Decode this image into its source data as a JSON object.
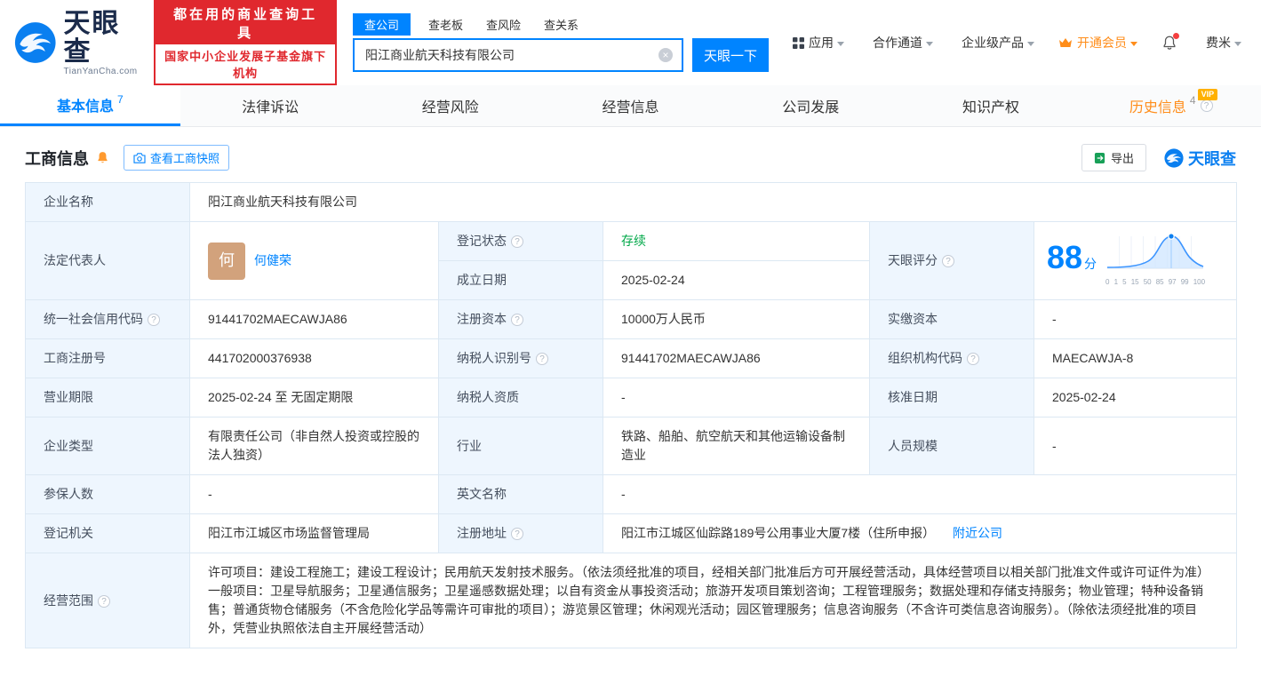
{
  "header": {
    "logo_title": "天眼查",
    "logo_domain": "TianYanCha.com",
    "slogan_line1": "都在用的商业查询工具",
    "slogan_line2": "国家中小企业发展子基金旗下机构",
    "search_tabs": [
      {
        "label": "查公司"
      },
      {
        "label": "查老板"
      },
      {
        "label": "查风险"
      },
      {
        "label": "查关系"
      }
    ],
    "search_value": "阳江商业航天科技有限公司",
    "search_button": "天眼一下",
    "nav_app": "应用",
    "nav_coop": "合作通道",
    "nav_enterprise": "企业级产品",
    "nav_vip": "开通会员",
    "nav_user": "费米"
  },
  "tabs": {
    "basic": {
      "label": "基本信息",
      "count": "7"
    },
    "legal": {
      "label": "法律诉讼"
    },
    "risk": {
      "label": "经营风险"
    },
    "operation": {
      "label": "经营信息"
    },
    "development": {
      "label": "公司发展"
    },
    "ip": {
      "label": "知识产权"
    },
    "history": {
      "label": "历史信息",
      "count": "4",
      "vip_tag": "VIP"
    }
  },
  "section": {
    "title": "工商信息",
    "snapshot_button": "查看工商快照",
    "export_button": "导出",
    "watermark": "天眼查"
  },
  "biz": {
    "company_name_label": "企业名称",
    "company_name_value": "阳江商业航天科技有限公司",
    "legal_rep_label": "法定代表人",
    "legal_rep_avatar": "何",
    "legal_rep_name": "何健荣",
    "reg_status_label": "登记状态",
    "reg_status_value": "存续",
    "score_label": "天眼评分",
    "score_value": "88",
    "score_unit": "分",
    "establish_label": "成立日期",
    "establish_value": "2025-02-24",
    "credit_code_label": "统一社会信用代码",
    "credit_code_value": "91441702MAECAWJA86",
    "reg_capital_label": "注册资本",
    "reg_capital_value": "10000万人民币",
    "paid_capital_label": "实缴资本",
    "paid_capital_value": "-",
    "reg_no_label": "工商注册号",
    "reg_no_value": "441702000376938",
    "taxpayer_id_label": "纳税人识别号",
    "taxpayer_id_value": "91441702MAECAWJA86",
    "org_code_label": "组织机构代码",
    "org_code_value": "MAECAWJA-8",
    "term_label": "营业期限",
    "term_value": "2025-02-24 至 无固定期限",
    "taxpayer_quality_label": "纳税人资质",
    "taxpayer_quality_value": "-",
    "approve_date_label": "核准日期",
    "approve_date_value": "2025-02-24",
    "company_type_label": "企业类型",
    "company_type_value": "有限责任公司（非自然人投资或控股的法人独资）",
    "industry_label": "行业",
    "industry_value": "铁路、船舶、航空航天和其他运输设备制造业",
    "staff_label": "人员规模",
    "staff_value": "-",
    "insured_label": "参保人数",
    "insured_value": "-",
    "english_label": "英文名称",
    "english_value": "-",
    "authority_label": "登记机关",
    "authority_value": "阳江市江城区市场监督管理局",
    "address_label": "注册地址",
    "address_value": "阳江市江城区仙踪路189号公用事业大厦7楼（住所申报）",
    "nearby_link": "附近公司",
    "scope_label": "经营范围",
    "scope_value": "许可项目：建设工程施工；建设工程设计；民用航天发射技术服务。（依法须经批准的项目，经相关部门批准后方可开展经营活动，具体经营项目以相关部门批准文件或许可证件为准）一般项目：卫星导航服务；卫星通信服务；卫星遥感数据处理；以自有资金从事投资活动；旅游开发项目策划咨询；工程管理服务；数据处理和存储支持服务；物业管理；特种设备销售；普通货物仓储服务（不含危险化学品等需许可审批的项目）；游览景区管理；休闲观光活动；园区管理服务；信息咨询服务（不含许可类信息咨询服务）。（除依法须经批准的项目外，凭营业执照依法自主开展经营活动）"
  },
  "score_chart": {
    "type": "area",
    "ticks": [
      "0",
      "1",
      "5",
      "15",
      "50",
      "85",
      "97",
      "99",
      "100"
    ],
    "score": 88,
    "accent_color": "#0084ff"
  },
  "colors": {
    "brand_blue": "#0084ff",
    "brand_red": "#e0282e",
    "vip_orange": "#ff8d1a",
    "status_green": "#00a848",
    "label_bg": "#eef6fe"
  }
}
